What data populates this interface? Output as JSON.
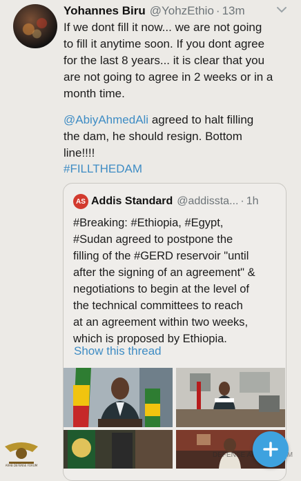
{
  "tweet": {
    "author_name": "Yohannes Biru",
    "handle": "@YohzEthio",
    "separator": "·",
    "time": "13m",
    "lines": [
      "If we dont fill it now... we are not going",
      "to fill it anytime soon. If you dont agree",
      "for the last 8 years... it is clear that you",
      "are not going to agree in 2 weeks or in a",
      "month time."
    ],
    "mention": "@AbiyAhmedAli",
    "para2_line1_rest": " agreed to halt filling",
    "para2_line2": "the dam, he should resign. Bottom",
    "para2_line3": "line!!!!",
    "hashtag": "#FILLTHEDAM"
  },
  "quoted": {
    "logo_text": "AS",
    "author_name": "Addis Standard",
    "handle": "@addissta...",
    "separator": "·",
    "time": "1h",
    "lines": [
      "#Breaking: #Ethiopia, #Egypt,",
      "#Sudan agreed to postpone the",
      "filling of the #GERD reservoir \"until",
      "after the signing of an agreement\" &",
      "negotiations to begin at the level of",
      "the technical committees to reach",
      "at an agreement within two weeks,",
      "which is proposed by Ethiopia."
    ],
    "show_thread": "Show this thread"
  },
  "watermark": {
    "left_caption": "ARAB DEFENSE FORUM",
    "right_text": "DEFENSE ARAB FORUM"
  },
  "icons": {
    "chevron": "chevron-down-icon",
    "compose": "compose-plus-icon"
  }
}
